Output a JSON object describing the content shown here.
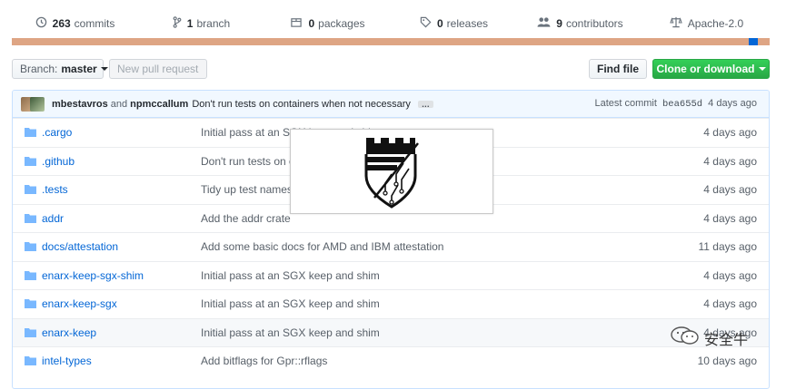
{
  "summary": {
    "commits": {
      "count": "263",
      "label": "commits",
      "icon": "history-icon"
    },
    "branches": {
      "count": "1",
      "label": "branch",
      "icon": "git-branch-icon"
    },
    "packages": {
      "count": "0",
      "label": "packages",
      "icon": "package-icon"
    },
    "releases": {
      "count": "0",
      "label": "releases",
      "icon": "tag-icon"
    },
    "contributors": {
      "count": "9",
      "label": "contributors",
      "icon": "people-icon"
    },
    "license": {
      "label": "Apache-2.0",
      "icon": "law-icon"
    }
  },
  "language_bar": {
    "primary_color": "#dea584",
    "secondary_color": "#0366d6",
    "tertiary_color": "#f1e05a"
  },
  "toolbar": {
    "branch_prefix": "Branch:",
    "branch_name": "master",
    "new_pr_label": "New pull request",
    "find_file_label": "Find file",
    "clone_label": "Clone or download"
  },
  "latest_commit": {
    "author1": "mbestavros",
    "and_text": "and",
    "author2": "npmccallum",
    "message": "Don't run tests on containers when not necessary",
    "ellipsis": "…",
    "prefix": "Latest commit",
    "sha": "bea655d",
    "age": "4 days ago"
  },
  "files": [
    {
      "name": ".cargo",
      "message": "Initial pass at an SGX keep and shim",
      "age": "4 days ago"
    },
    {
      "name": ".github",
      "message": "Don't run tests on containers when not necessary",
      "age": "4 days ago"
    },
    {
      "name": ".tests",
      "message": "Tidy up test names",
      "age": "4 days ago"
    },
    {
      "name": "addr",
      "message": "Add the addr crate",
      "age": "4 days ago"
    },
    {
      "name": "docs/attestation",
      "message": "Add some basic docs for AMD and IBM attestation",
      "age": "11 days ago"
    },
    {
      "name": "enarx-keep-sgx-shim",
      "message": "Initial pass at an SGX keep and shim",
      "age": "4 days ago"
    },
    {
      "name": "enarx-keep-sgx",
      "message": "Initial pass at an SGX keep and shim",
      "age": "4 days ago"
    },
    {
      "name": "enarx-keep",
      "message": "Initial pass at an SGX keep and shim",
      "age": "4 days ago"
    },
    {
      "name": "intel-types",
      "message": "Add bitflags for Gpr::rflags",
      "age": "10 days ago"
    }
  ],
  "watermark": {
    "text": "安全牛",
    "icon": "wechat-icon"
  }
}
